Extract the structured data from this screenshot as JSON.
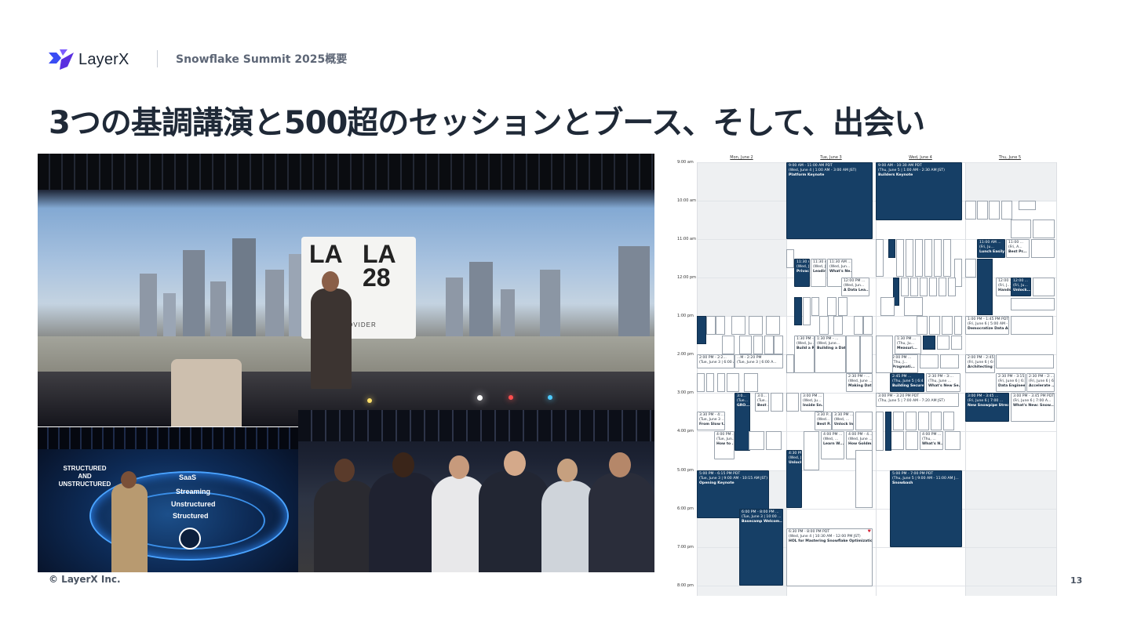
{
  "header": {
    "brand": "LayerX",
    "section": "Snowflake Summit 2025概要"
  },
  "slide": {
    "title": "3つの基調講演と500超のセッションとブース、そして、出会い"
  },
  "photos": {
    "keynote_sign": {
      "line1": "LA",
      "line2": "28",
      "caption": "IAL PROVIDER"
    },
    "data_stage": {
      "line1": "STRUCTURED",
      "line2": "AND",
      "line3": "UNSTRUCTURED",
      "ring1": "SaaS",
      "ring2": "Streaming",
      "ring3": "Unstructured",
      "ring4": "Structured"
    }
  },
  "calendar": {
    "days": [
      "Mon, June 2",
      "Tue, June 3",
      "Wed, June 4",
      "Thu, June 5"
    ],
    "times": [
      "9:00 am",
      "10:00 am",
      "11:00 am",
      "12:00 pm",
      "1:00 pm",
      "2:00 pm",
      "3:00 pm",
      "4:00 pm",
      "5:00 pm",
      "6:00 pm",
      "7:00 pm",
      "8:00 pm"
    ],
    "events": {
      "platform": {
        "time": "9:00 AM - 11:00 AM PDT",
        "sub": "(Wed, June 4 | 1:00 AM - 3:00 AM JST)",
        "title": "Platform Keynote"
      },
      "builders": {
        "time": "9:00 AM - 10:30 AM PDT",
        "sub": "(Thu, June 5 | 1:00 AM - 2:30 AM JST)",
        "title": "Builders Keynote"
      },
      "opening": {
        "time": "5:00 PM - 6:15 PM PDT",
        "sub": "(Tue, June 3 | 9:00 AM - 10:15 AM JST)",
        "title": "Opening Keynote"
      },
      "basecamp": {
        "time": "6:00 PM - 8:00 PM ...",
        "sub": "(Tue, June 3 | 10:00 ...",
        "title": "Basecamp Welcom..."
      },
      "hol": {
        "time": "6:30 PM - 8:00 PM PDT",
        "sub": "(Wed, June 4 | 10:30 AM - 12:00 PM JST)",
        "title": "HOL for Mastering Snowflake Optimizatio..."
      },
      "snowbash": {
        "time": "5:00 PM - 7:00 PM PDT",
        "sub": "(Thu, June 5 | 9:00 AM - 11:00 AM J...",
        "title": "Snowbash"
      },
      "democratize": {
        "time": "1:00 PM - 1:45 PM PDT",
        "sub": "(Fri, June 6 | 5:00 AM - ...",
        "title": "Democratize Data Asset Discovery ..."
      },
      "architecting": {
        "time": "2:00 PM - 2:45 ...",
        "sub": "(Fri, June 6 | 6:0...",
        "title": "Architecting Scalable ..."
      },
      "new_snowpipe": {
        "time": "3:00 PM - 3:45 ...",
        "sub": "(Fri, June 6 | 7:00 ...",
        "title": "New Snowpipe Stream..."
      },
      "whats_new_snow": {
        "time": "3:00 PM - 3:45 PM PDT",
        "sub": "(Fri, June 6 | 7:00 A...",
        "title": "What's New: Snow..."
      },
      "data_engineer": {
        "time": "2:30 PM - 3:15 ...",
        "sub": "(Fri, June 6 | 6:3...",
        "title": "Data Engineer..."
      },
      "accelerate": {
        "time": "2:30 PM - 2:...",
        "sub": "(Fri, June 6 | 6...",
        "title": "Accelerate ..."
      },
      "building_secure": {
        "time": "2:45 PM ...",
        "sub": "(Thu, June 5 | 6:45...",
        "title": "Building Secure, Sca..."
      },
      "whats_new_se": {
        "time": "2:30 PM - 3:...",
        "sub": "(Thu, June ...",
        "title": "What's New Se..."
      },
      "lunch_easily": {
        "time": "11:00 AM ...",
        "sub": "(Fri, Ju...",
        "title": "Lunch Easily"
      },
      "hands_on": {
        "time": "12:00 ...",
        "sub": "(Fri, J...",
        "title": "Hands..."
      },
      "unlock": {
        "time": "12:00 ...",
        "sub": "(Fri, Ju...",
        "title": "Unlock..."
      },
      "best_pr": {
        "time": "11:00 ...",
        "sub": "(Fri, A...",
        "title": "Best Pr..."
      },
      "from_slow": {
        "time": "3:30 PM - 4:...",
        "sub": "(Tue, June 3 ...",
        "title": "From Slow t..."
      },
      "privacy": {
        "time": "11:30 AM ...",
        "sub": "(Wed, J...",
        "title": "Privacy..."
      },
      "leading": {
        "time": "11:30 AM ...",
        "sub": "(Wed, J...",
        "title": "Leading..."
      },
      "whats_ne": {
        "time": "11:30 AM ...",
        "sub": "(Wed, Jun...",
        "title": "What's Ne..."
      },
      "a_data_lea": {
        "time": "12:00 PM ...",
        "sub": "(Wed, Jun...",
        "title": "A Data Lea..."
      },
      "build_a_re": {
        "time": "1:30 PM - ...",
        "sub": "(Wed, Ju...",
        "title": "Build a Re..."
      },
      "building_a_dat": {
        "time": "1:30 PM - ...",
        "sub": "(Wed, June...",
        "title": "Building a Dat..."
      },
      "making_dat": {
        "time": "2:30 PM - ...",
        "sub": "(Wed, June ...",
        "title": "Making Dat..."
      },
      "inside_sn": {
        "time": "3:00 PM ...",
        "sub": "(Wed, Ju...",
        "title": "Inside Sn..."
      },
      "best_p": {
        "time": "3:30 P...",
        "sub": "(Wed...",
        "title": "Best P..."
      },
      "unlock_in": {
        "time": "3:30 PM ...",
        "sub": "(Wed, ...",
        "title": "Unlock In..."
      },
      "learn_w": {
        "time": "4:00 PM ...",
        "sub": "(Wed, ...",
        "title": "Learn W..."
      },
      "how_goldm": {
        "time": "4:00 PM - 4...",
        "sub": "(Wed, June ...",
        "title": "How Goldm..."
      },
      "pragmati": {
        "time": "2:00 PM ...",
        "sub": "(Thu, J...",
        "title": "Pragmati..."
      },
      "measuri": {
        "time": "1:30 PM ...",
        "sub": "(Thu, Ju...",
        "title": "Measuri..."
      },
      "whats_n": {
        "time": "4:00 PM ...",
        "sub": "(Thu, ...",
        "title": "What's N..."
      },
      "thu_3pm": {
        "time": "3:00 PM - 3:20 PM PDT",
        "sub": "(Thu, June 5 | 7:00 AM - 7:20 AM JST)",
        "title": ""
      },
      "tue_2pm": {
        "time": "2:00 PM - 2:2...",
        "sub": "(Tue, June 3 | 6:00 AM...",
        "title": ""
      },
      "tue_2pm_b": {
        "time": "...M - 2:20 PM",
        "sub": "(Tue, June 3 | 6:00 A...",
        "title": ""
      },
      "how_to": {
        "time": "4:00 PM ...",
        "sub": "(Tue, Jun...",
        "title": "How to ..."
      },
      "gro": {
        "time": "3:0...",
        "sub": "(Tue...",
        "title": "GRO..."
      },
      "best_tue": {
        "time": "3:0...",
        "sub": "(Tue...",
        "title": "Best ..."
      },
      "unlock_wed": {
        "time": "4:30 PM ...",
        "sub": "(Wed, J...",
        "title": "Unlock I..."
      }
    }
  },
  "footer": {
    "copyright": "© LayerX Inc.",
    "page": "13"
  },
  "colors": {
    "title": "#1f2937",
    "brand": "#4a3aff",
    "event_dark": "#163f66",
    "heart": "#d62b3b"
  }
}
